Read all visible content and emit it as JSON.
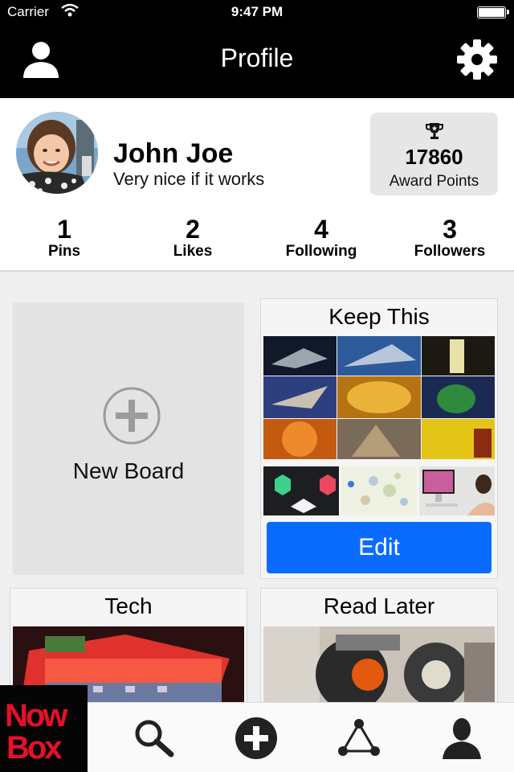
{
  "status_bar": {
    "carrier": "Carrier",
    "time": "9:47 PM"
  },
  "nav": {
    "title": "Profile",
    "left_icon": "user-icon",
    "right_icon": "gear-icon"
  },
  "profile": {
    "name": "John Joe",
    "bio": "Very nice if it works",
    "award": {
      "points": "17860",
      "label": "Award Points",
      "icon": "trophy-icon"
    }
  },
  "stats": [
    {
      "value": "1",
      "label": "Pins"
    },
    {
      "value": "2",
      "label": "Likes"
    },
    {
      "value": "4",
      "label": "Following"
    },
    {
      "value": "3",
      "label": "Followers"
    }
  ],
  "boards": {
    "new_board_label": "New Board",
    "keep_this": {
      "title": "Keep This",
      "edit_label": "Edit"
    },
    "tech": {
      "title": "Tech"
    },
    "read_later": {
      "title": "Read Later"
    }
  },
  "tab_bar": {
    "logo": {
      "line1": "Now",
      "line2": "Box"
    },
    "tabs": [
      "search-icon",
      "add-icon",
      "network-icon",
      "profile-icon"
    ]
  },
  "colors": {
    "accent": "#0a6cff",
    "bars": "#000000",
    "logo_red": "#e5102a"
  }
}
